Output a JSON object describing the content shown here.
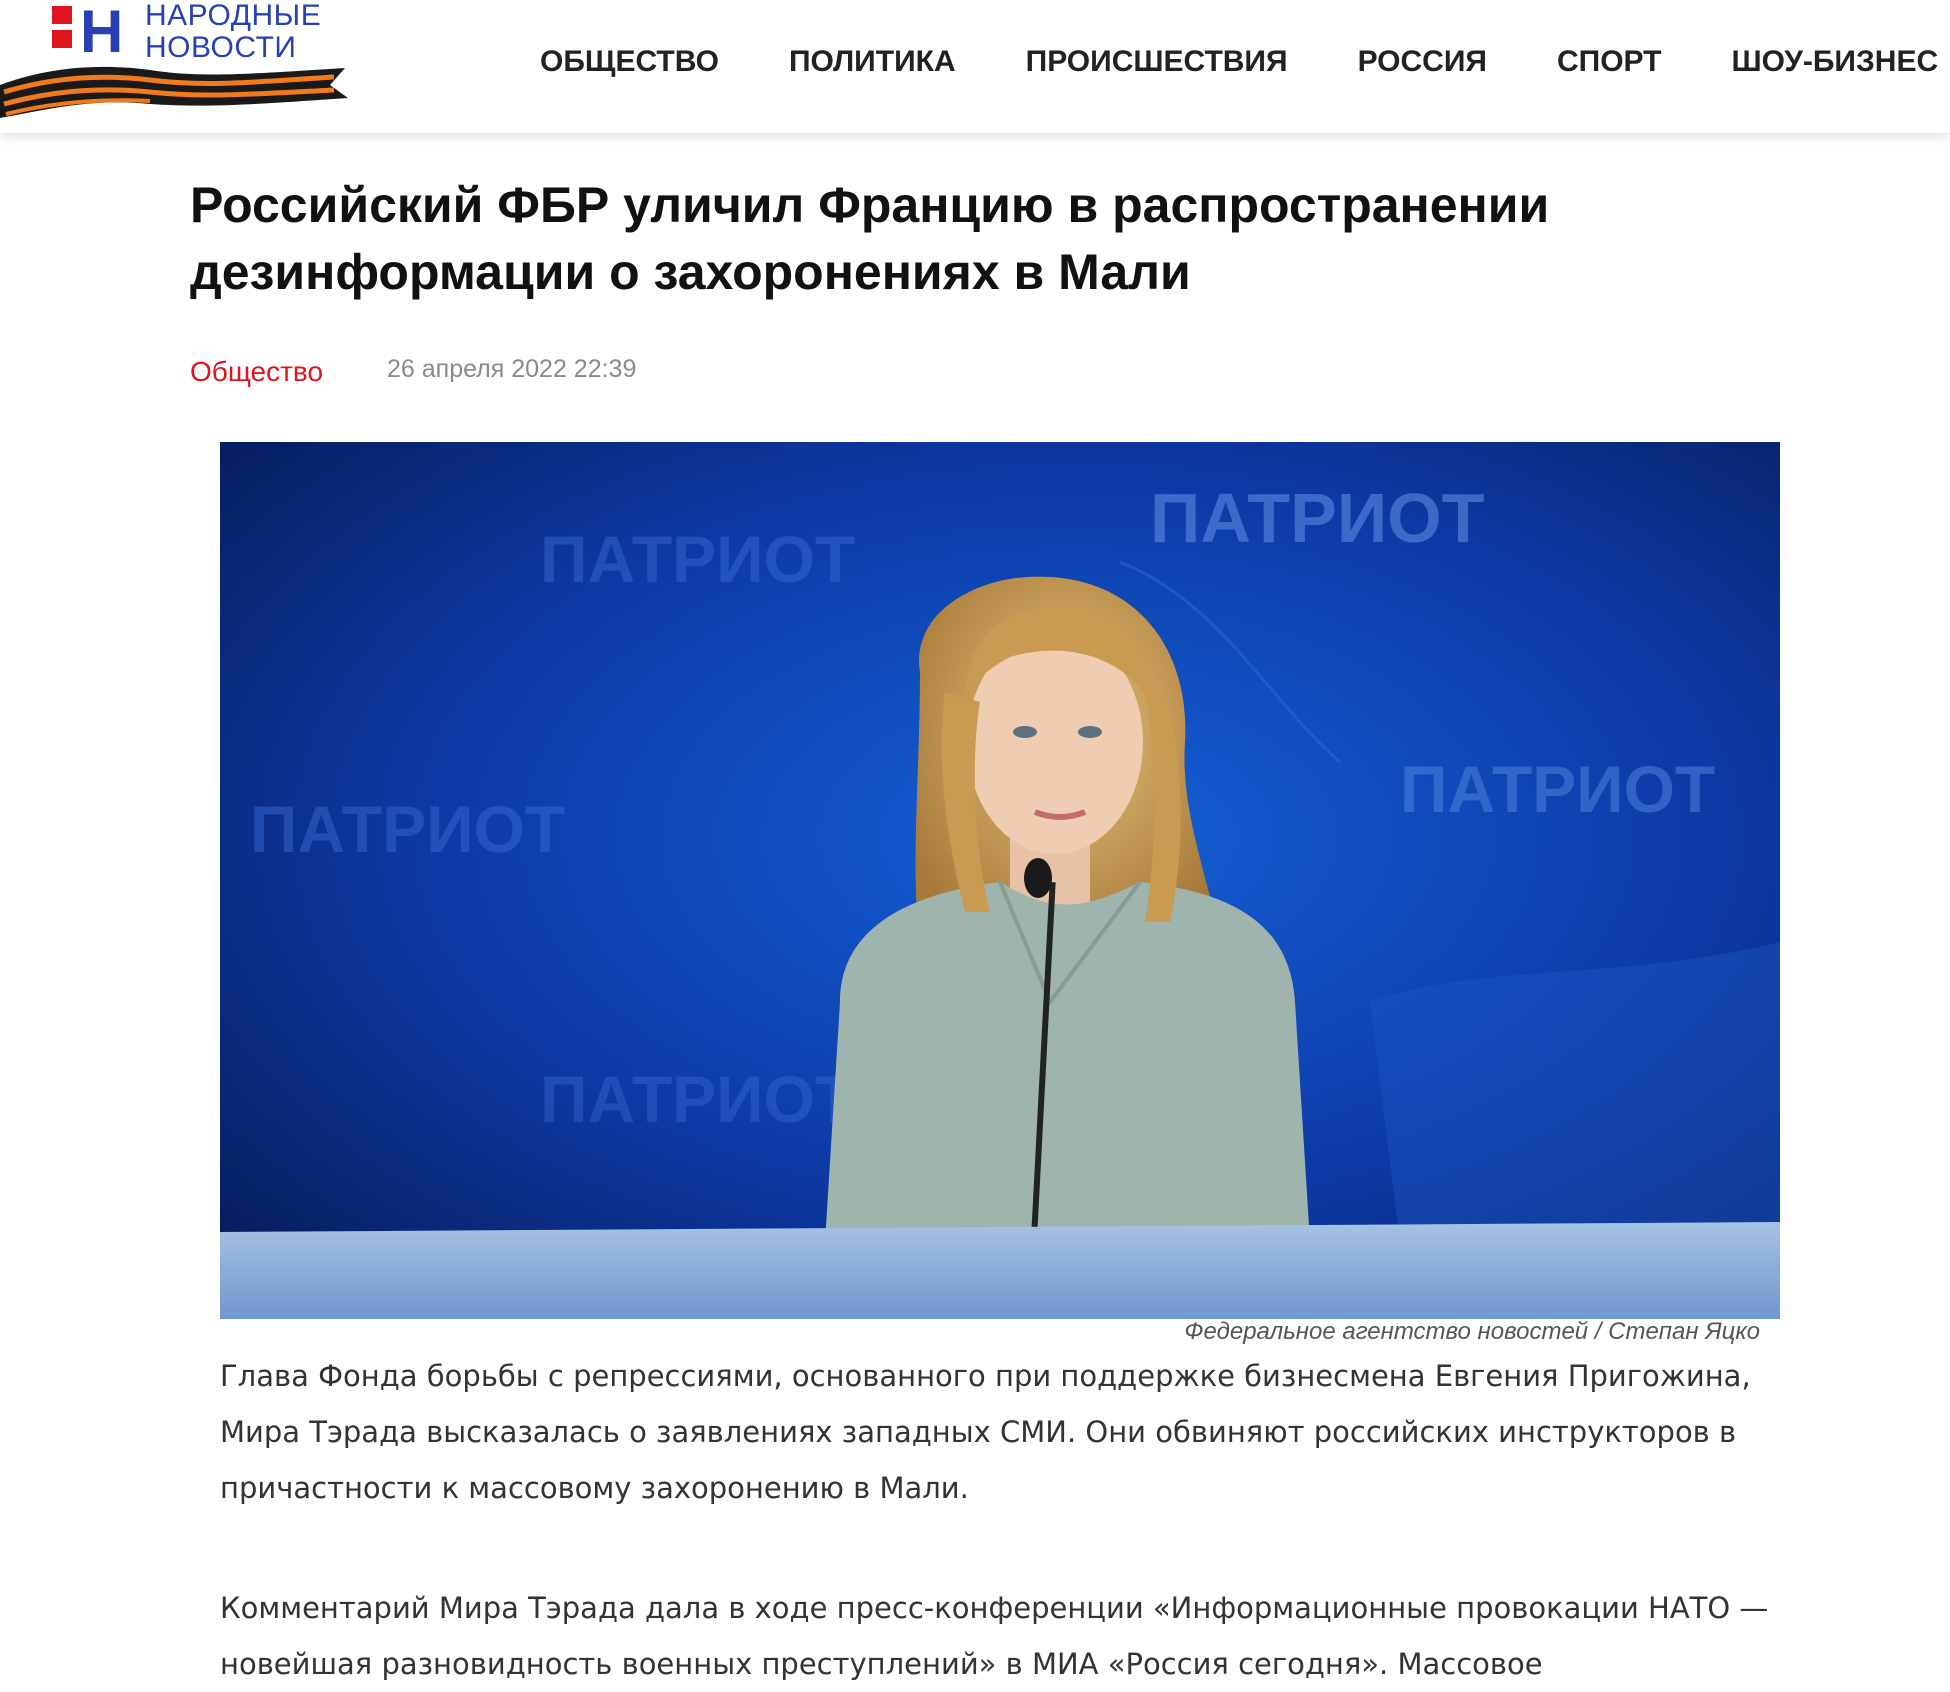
{
  "header": {
    "logo": {
      "letter": "Н",
      "line1": "НАРОДНЫЕ",
      "line2": "НОВОСТИ"
    },
    "nav": [
      {
        "label": "ОБЩЕСТВО"
      },
      {
        "label": "ПОЛИТИКА"
      },
      {
        "label": "ПРОИСШЕСТВИЯ"
      },
      {
        "label": "РОССИЯ"
      },
      {
        "label": "СПОРТ"
      },
      {
        "label": "ШОУ-БИЗНЕС"
      }
    ]
  },
  "article": {
    "title_line1": "Российский ФБР уличил Францию в распространении",
    "title_line2": "дезинформации о захоронениях в Мали",
    "category": "Общество",
    "date": "26 апреля 2022 22:39",
    "photo": {
      "backdrop_word": "ПАТРИОТ",
      "caption": "Федеральное агентство новостей / Степан Яцко"
    },
    "paragraphs": [
      "Глава Фонда борьбы с репрессиями, основанного при поддержке бизнесмена Евгения Пригожина, Мира Тэрада высказалась о заявлениях западных СМИ. Они обвиняют российских инструкторов в причастности к массовому захоронению в Мали.",
      "Комментарий Мира Тэрада дала в ходе пресс-конференции «Информационные провокации НАТО — новейшая разновидность военных преступлений» в МИА «Россия сегодня». Массовое"
    ]
  },
  "colors": {
    "accent_red": "#e0141e",
    "logo_blue": "#2840b6",
    "ribbon_orange": "#f07a1c",
    "ribbon_black": "#1a1a1a",
    "backdrop_blue": "#0c3aa6"
  }
}
